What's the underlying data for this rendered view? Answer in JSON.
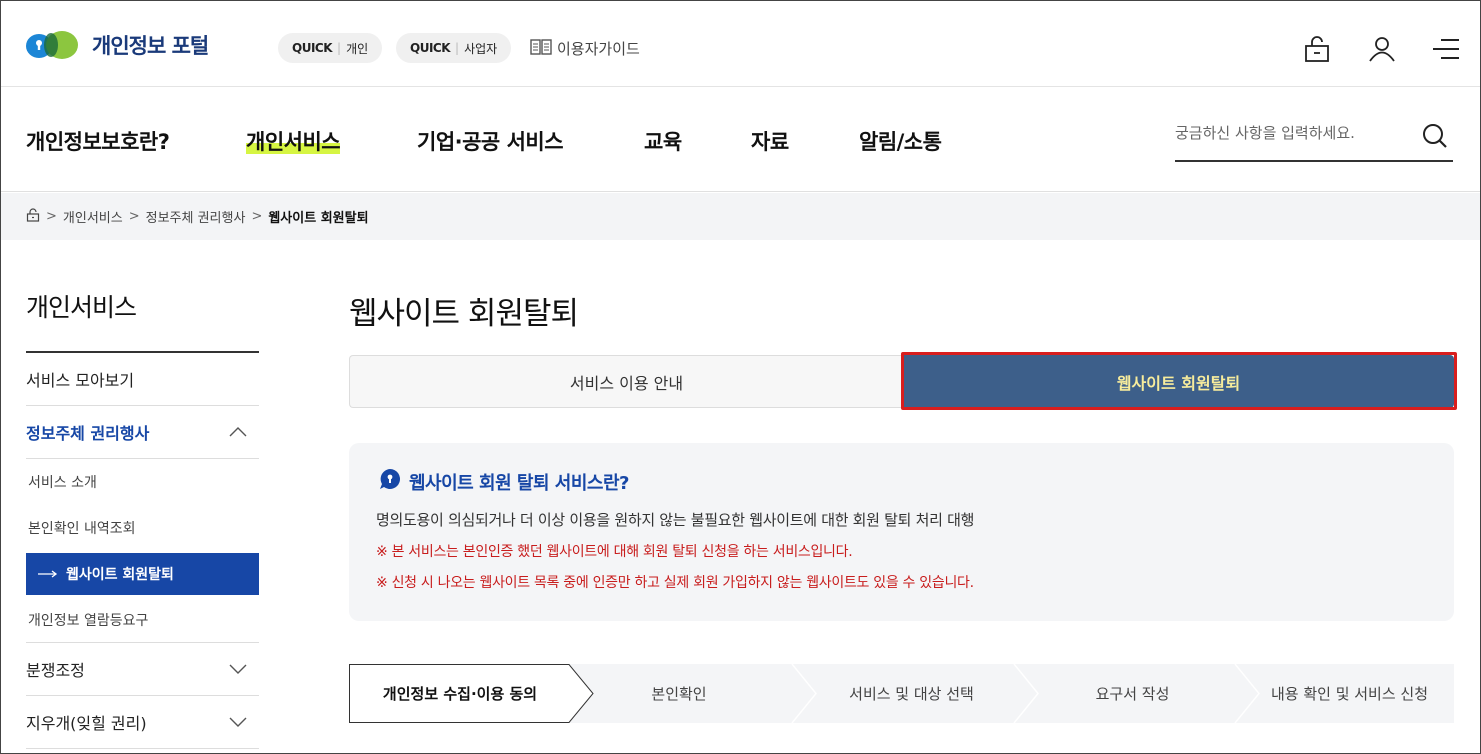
{
  "header": {
    "logo_text": "개인정보 포털",
    "quick_personal": {
      "q": "QUICK",
      "label": "개인"
    },
    "quick_business": {
      "q": "QUICK",
      "label": "사업자"
    },
    "guide_label": "이용자가이드",
    "icons": [
      "lock-icon",
      "user-icon",
      "menu-icon"
    ]
  },
  "gnb": {
    "items": [
      "개인정보보호란?",
      "개인서비스",
      "기업·공공 서비스",
      "교육",
      "자료",
      "알림/소통"
    ],
    "active_index": 1,
    "search_placeholder": "궁금하신 사항을 입력하세요."
  },
  "breadcrumb": {
    "items": [
      "개인서비스",
      "정보주체 권리행사",
      "웹사이트 회원탈퇴"
    ]
  },
  "sidebar": {
    "title": "개인서비스",
    "items": [
      {
        "label": "서비스 모아보기"
      },
      {
        "label": "정보주체 권리행사",
        "open": true
      },
      {
        "label": "분쟁조정"
      },
      {
        "label": "지우개(잊힐 권리)"
      }
    ],
    "sub_items": [
      "서비스 소개",
      "본인확인 내역조회",
      "웹사이트 회원탈퇴",
      "개인정보 열람등요구"
    ],
    "active_sub_dash": "—"
  },
  "main": {
    "title": "웹사이트 회원탈퇴",
    "tabs": [
      "서비스 이용 안내",
      "웹사이트 회원탈퇴"
    ],
    "active_tab": 1,
    "info": {
      "heading": "웹사이트 회원 탈퇴 서비스란?",
      "description": "명의도용이 의심되거나 더 이상 이용을 원하지 않는 불필요한 웹사이트에 대한 회원 탈퇴 처리 대행",
      "notice_1": "※ 본 서비스는 본인인증 했던 웹사이트에 대해 회원 탈퇴 신청을 하는 서비스입니다.",
      "notice_2": "※ 신청 시 나오는 웹사이트 목록 중에 인증만 하고 실제 회원 가입하지 않는 웹사이트도 있을 수 있습니다."
    },
    "steps": [
      "개인정보 수집·이용 동의",
      "본인확인",
      "서비스 및 대상 선택",
      "요구서 작성",
      "내용 확인 및 서비스 신청"
    ],
    "current_step": 0
  },
  "colors": {
    "primary": "#1747a6",
    "tab_active_bg": "#3d5f8a",
    "tab_active_text": "#f7ec9c",
    "highlight_box": "#d81e1e",
    "warning_text": "#c81d1d",
    "gnb_active_underline": "#d6f542"
  }
}
